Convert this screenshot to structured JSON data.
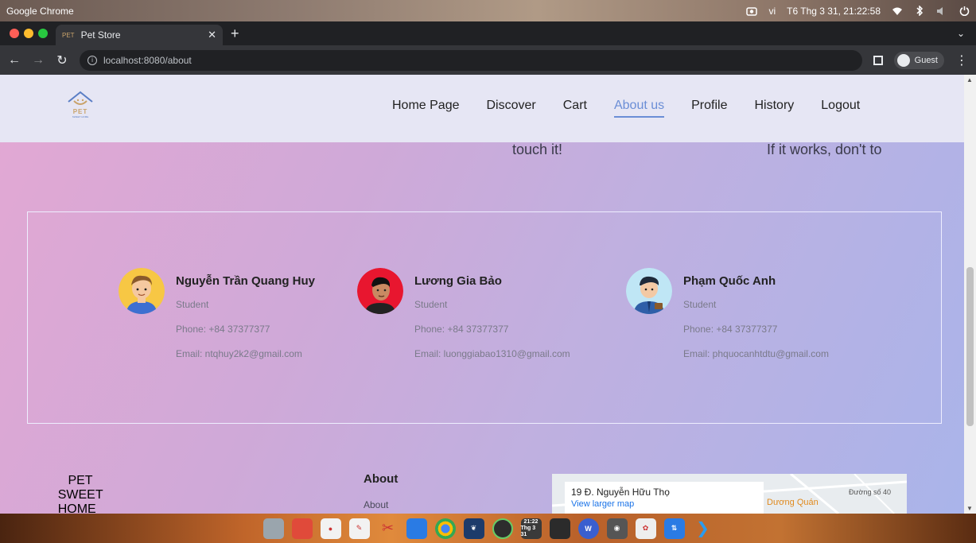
{
  "os": {
    "app_name": "Google Chrome",
    "lang": "vi",
    "datetime": "T6 Thg 3 31, 21:22:58"
  },
  "browser": {
    "tab_title": "Pet Store",
    "tab_favicon": "PET",
    "url": "localhost:8080/about",
    "profile_label": "Guest"
  },
  "header": {
    "logo_text": "PET",
    "logo_sub": "SWEET HOME",
    "nav": [
      {
        "label": "Home Page"
      },
      {
        "label": "Discover"
      },
      {
        "label": "Cart"
      },
      {
        "label": "About us"
      },
      {
        "label": "Profile"
      },
      {
        "label": "History"
      },
      {
        "label": "Logout"
      }
    ],
    "active_nav": "About us",
    "accent_color": "#6b8ed6"
  },
  "quotes": {
    "left": "touch it!",
    "right": "If it works, don't to"
  },
  "members": [
    {
      "name": "Nguyễn Trần Quang Huy",
      "role": "Student",
      "phone": "Phone: +84 37377377",
      "email": "Email: ntqhuy2k2@gmail.com"
    },
    {
      "name": "Lương Gia Bảo",
      "role": "Student",
      "phone": "Phone: +84 37377377",
      "email": "Email: luonggiabao1310@gmail.com"
    },
    {
      "name": "Phạm Quốc Anh",
      "role": "Student",
      "phone": "Phone: +84 37377377",
      "email": "Email: phquocanhtdtu@gmail.com"
    }
  ],
  "footer": {
    "about_heading": "About",
    "about_link": "About",
    "map_address": "19 Đ. Nguyễn Hữu Thọ",
    "map_link": "View larger map",
    "map_road": "Đường số 40",
    "map_poi": "Dương Quán"
  },
  "dock": {
    "clock_time": "21:22",
    "clock_date": "Thg 3 31"
  }
}
